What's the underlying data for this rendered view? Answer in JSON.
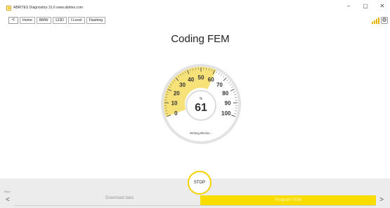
{
  "window": {
    "title": "ABRITES Diagnostics 31.6   www.abrites.com",
    "minimize_glyph": "–",
    "maximize_glyph": "▢",
    "close_glyph": "✕"
  },
  "nav": {
    "back_glyph": "<",
    "breadcrumbs": [
      "Home",
      "BMW",
      "123D",
      "I-Level",
      "Flashing"
    ]
  },
  "main": {
    "title": "Coding FEM",
    "gauge": {
      "value": 61,
      "value_text": "61",
      "unit": "%",
      "status": "Writing Blocks...",
      "min": 0,
      "max": 100,
      "tick_labels": [
        "0",
        "10",
        "20",
        "30",
        "40",
        "50",
        "60",
        "70",
        "80",
        "90",
        "100"
      ]
    }
  },
  "footer": {
    "step_label": "Steps",
    "stop_label": "STOP",
    "prev_glyph": "<",
    "next_glyph": ">",
    "steps": [
      "Download data",
      "Program FEM"
    ],
    "active_step": 1
  },
  "colors": {
    "accent": "#fadd00",
    "gauge_fill": "#f7e27a",
    "footer_bg": "#ececec"
  },
  "icons": {
    "app": "abrites-logo-icon",
    "signal": "signal-bars-icon",
    "settings": "gear-icon"
  }
}
